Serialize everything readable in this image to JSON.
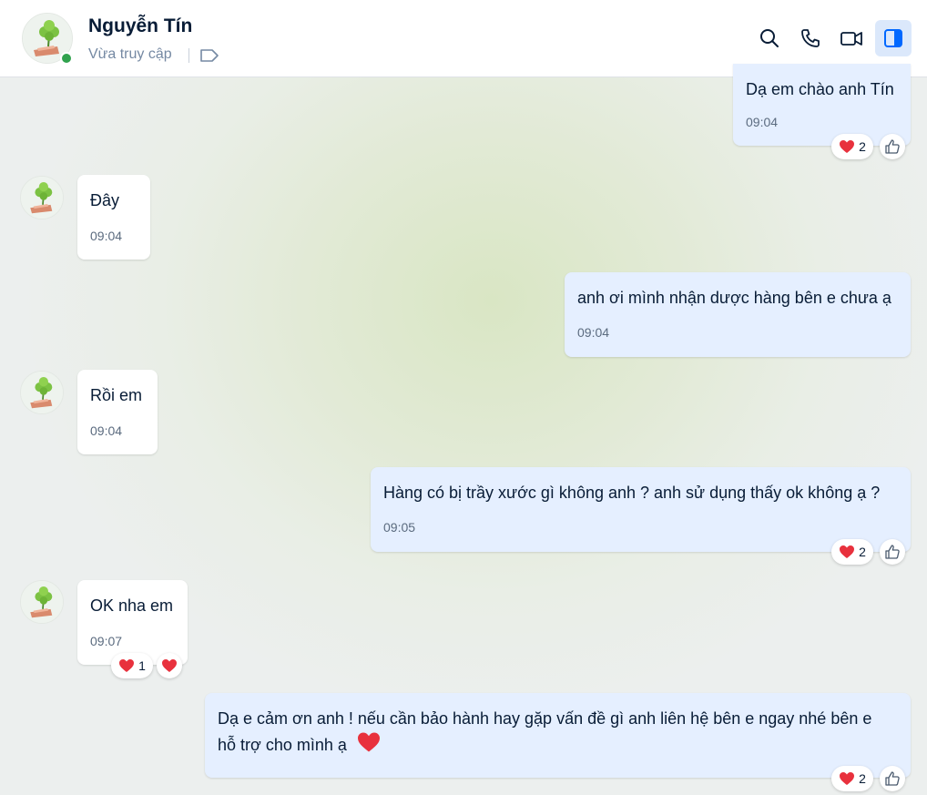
{
  "header": {
    "contact_name": "Nguyễn Tín",
    "status": "Vừa truy cập",
    "icons": [
      "search-icon",
      "phone-icon",
      "video-icon",
      "sidebar-toggle-icon",
      "tag-icon"
    ]
  },
  "messages": [
    {
      "side": "out",
      "text": "Dạ em chào anh Tín",
      "time": "09:04",
      "reaction_count": "2"
    },
    {
      "side": "in",
      "text": "Đây",
      "time": "09:04"
    },
    {
      "side": "out",
      "text": "anh ơi mình nhận dược hàng bên e chưa ạ",
      "time": "09:04"
    },
    {
      "side": "in",
      "text": "Rồi em",
      "time": "09:04"
    },
    {
      "side": "out",
      "text": "Hàng có bị trầy xước gì không anh ? anh sử dụng thấy ok không ạ ?",
      "time": "09:05",
      "reaction_count": "2"
    },
    {
      "side": "in",
      "text": "OK nha em",
      "time": "09:07",
      "reaction_count": "1"
    },
    {
      "side": "out",
      "text_line1": "Dạ e cảm ơn anh ! nếu cần bảo hành hay gặp vấn đề gì anh liên hệ bên e ngay nhé bên e",
      "text_line2": "hỗ trợ cho mình ạ",
      "reaction_count": "2"
    }
  ],
  "colors": {
    "heart": "#e8313d",
    "accent": "#0068ff",
    "online": "#30a24d"
  }
}
